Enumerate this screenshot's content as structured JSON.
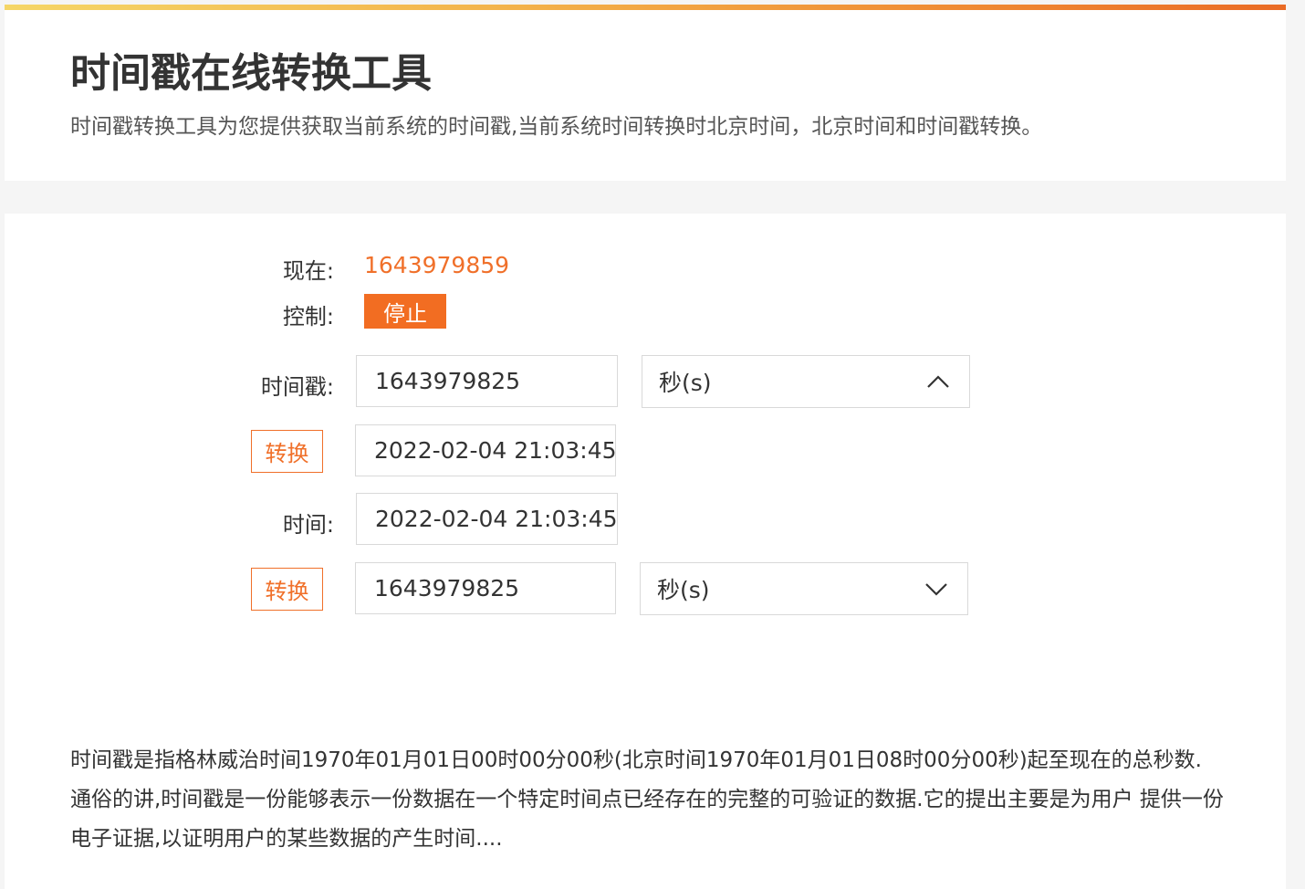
{
  "header": {
    "title": "时间戳在线转换工具",
    "subtitle": "时间戳转换工具为您提供获取当前系统的时间戳,当前系统时间转换时北京时间，北京时间和时间戳转换。"
  },
  "now": {
    "label": "现在:",
    "value": "1643979859"
  },
  "control": {
    "label": "控制:",
    "button": "停止"
  },
  "ts_to_time": {
    "label": "时间戳:",
    "input_value": "1643979825",
    "unit": "秒(s)",
    "convert_button": "转换",
    "result": "2022-02-04 21:03:45"
  },
  "time_to_ts": {
    "label": "时间:",
    "input_value": "2022-02-04 21:03:45",
    "convert_button": "转换",
    "result": "1643979825",
    "unit": "秒(s)"
  },
  "description": "时间戳是指格林威治时间1970年01月01日00时00分00秒(北京时间1970年01月01日08时00分00秒)起至现在的总秒数. 通俗的讲,时间戳是一份能够表示一份数据在一个特定时间点已经存在的完整的可验证的数据.它的提出主要是为用户 提供一份电子证据,以证明用户的某些数据的产生时间....",
  "colors": {
    "accent": "#f26d22",
    "accent_text": "#f0702a",
    "border": "#d9d9d9"
  }
}
